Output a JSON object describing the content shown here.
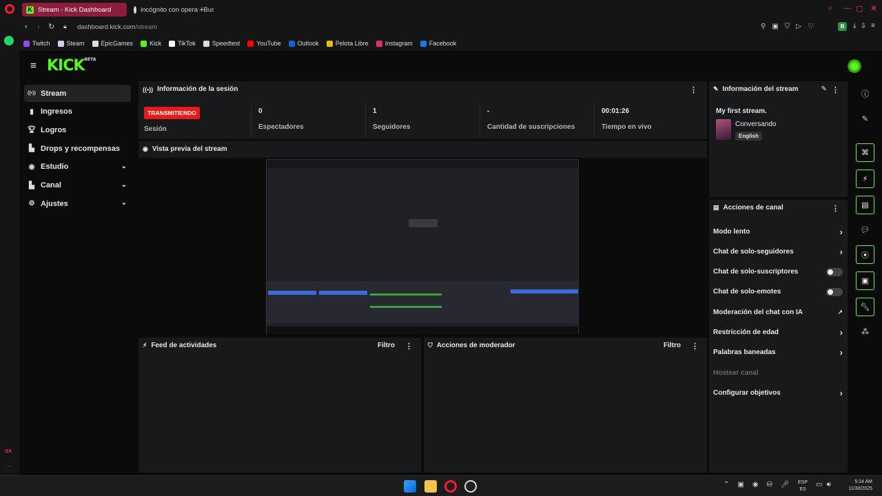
{
  "browser": {
    "tabs": [
      {
        "title": "Stream - Kick Dashboard",
        "active": true
      },
      {
        "title": "incógnito con opera - Bus",
        "active": false
      }
    ],
    "url_domain": "dashboard.kick.com",
    "url_path": "/stream",
    "profile_initial": "B",
    "bookmarks": [
      {
        "label": "Twitch",
        "color": "#9146ff"
      },
      {
        "label": "Steam",
        "color": "#c7d5e0"
      },
      {
        "label": "EpicGames",
        "color": "#dddddd"
      },
      {
        "label": "Kick",
        "color": "#53fc18"
      },
      {
        "label": "TikTok",
        "color": "#ffffff"
      },
      {
        "label": "Speedtest",
        "color": "#dddddd"
      },
      {
        "label": "YouTube",
        "color": "#ff0000"
      },
      {
        "label": "Outlook",
        "color": "#0a64d6"
      },
      {
        "label": "Pelota Libre",
        "color": "#e5c100"
      },
      {
        "label": "Instagram",
        "color": "#e1306c"
      },
      {
        "label": "Facebook",
        "color": "#1877f2"
      }
    ],
    "side_label": "GX"
  },
  "kick": {
    "brand_color": "#53fc18",
    "logo_text": "KICK",
    "logo_badge": "BETA"
  },
  "sidebar": {
    "items": [
      {
        "label": "Stream",
        "icon": "broadcast-icon",
        "active": true
      },
      {
        "label": "Ingresos",
        "icon": "chart-icon"
      },
      {
        "label": "Logros",
        "icon": "trophy-icon"
      },
      {
        "label": "Drops y recompensas",
        "icon": "gift-icon"
      },
      {
        "label": "Estudio",
        "icon": "camera-icon",
        "expandable": true
      },
      {
        "label": "Canal",
        "icon": "user-icon",
        "expandable": true
      },
      {
        "label": "Ajustes",
        "icon": "gear-icon",
        "expandable": true
      }
    ]
  },
  "session": {
    "title": "Información de la sesión",
    "status_badge": "TRANSMITIENDO",
    "status_label": "Sesión",
    "stats": [
      {
        "value": "0",
        "label": "Espectadores"
      },
      {
        "value": "1",
        "label": "Seguidores"
      },
      {
        "value": "-",
        "label": "Cantidad de suscripciones"
      },
      {
        "value": "00:01:26",
        "label": "Tiempo en vivo"
      }
    ]
  },
  "preview": {
    "title": "Vista previa del stream"
  },
  "activity": {
    "title": "Feed de actividades",
    "filter": "Filtro"
  },
  "moderator": {
    "title": "Acciones de moderador",
    "filter": "Filtro"
  },
  "stream_info": {
    "title": "Información del stream",
    "stream_title": "My first stream.",
    "category": "Conversando",
    "language": "English"
  },
  "channel_actions": {
    "title": "Acciones de canal",
    "items": [
      {
        "label": "Modo lento",
        "control": "arrow"
      },
      {
        "label": "Chat de solo-seguidores",
        "control": "arrow"
      },
      {
        "label": "Chat de solo-suscriptores",
        "control": "toggle"
      },
      {
        "label": "Chat de solo-emotes",
        "control": "toggle"
      },
      {
        "label": "Moderación del chat con IA",
        "control": "external"
      },
      {
        "label": "Restricción de edad",
        "control": "arrow"
      },
      {
        "label": "Palabras baneadas",
        "control": "arrow"
      },
      {
        "label": "Hostear canal",
        "control": "none",
        "disabled": true
      },
      {
        "label": "Configurar objetivos",
        "control": "arrow"
      }
    ]
  },
  "taskbar": {
    "lang_top": "ESP",
    "lang_bottom": "ES",
    "time": "5:14 AM",
    "date": "11/30/2025"
  }
}
